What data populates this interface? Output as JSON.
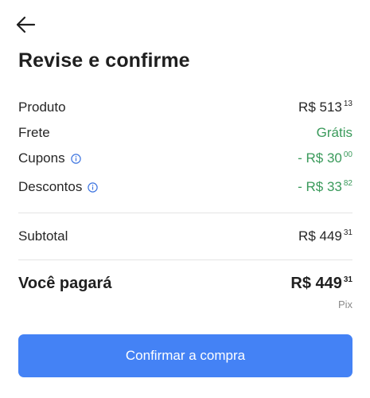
{
  "header": {
    "back_icon": "arrow-left-icon",
    "title": "Revise e confirme"
  },
  "summary": {
    "produto": {
      "label": "Produto",
      "main": "R$ 513",
      "cents": "13"
    },
    "frete": {
      "label": "Frete",
      "value": "Grátis"
    },
    "cupons": {
      "label": "Cupons",
      "info_icon": "info-icon",
      "main": "- R$ 30",
      "cents": "00"
    },
    "descontos": {
      "label": "Descontos",
      "info_icon": "info-icon",
      "main": "- R$ 33",
      "cents": "82"
    }
  },
  "subtotal": {
    "label": "Subtotal",
    "main": "R$ 449",
    "cents": "31"
  },
  "total": {
    "label": "Você pagará",
    "main": "R$ 449",
    "cents": "31",
    "payment_method": "Pix"
  },
  "actions": {
    "confirm_label": "Confirmar a compra"
  },
  "colors": {
    "accent": "#4482f5",
    "positive": "#3a9a5b",
    "info": "#3d74e0"
  }
}
